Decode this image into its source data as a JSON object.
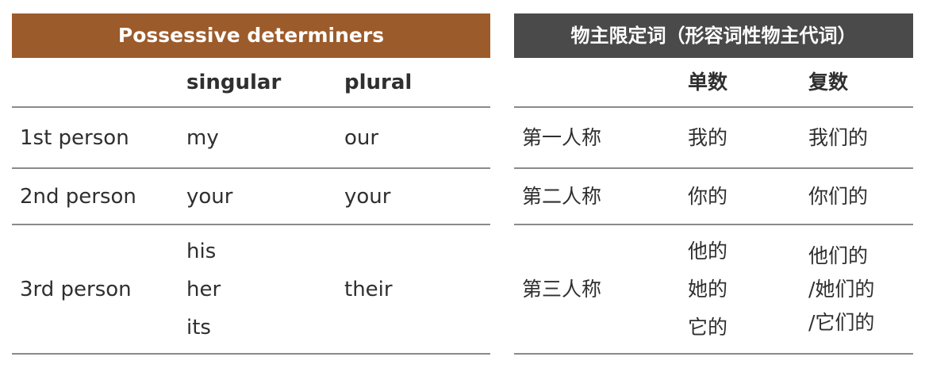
{
  "english_table": {
    "title": "Possessive determiners",
    "headers": [
      "",
      "singular",
      "plural"
    ],
    "rows": [
      {
        "person": "1st person",
        "singular": [
          "my"
        ],
        "plural": [
          "our"
        ]
      },
      {
        "person": "2nd person",
        "singular": [
          "your"
        ],
        "plural": [
          "your"
        ]
      },
      {
        "person": "3rd person",
        "singular": [
          "his",
          "her",
          "its"
        ],
        "plural": [
          "their"
        ]
      }
    ]
  },
  "chinese_table": {
    "title": "物主限定词（形容词性物主代词）",
    "headers": [
      "",
      "单数",
      "复数"
    ],
    "rows": [
      {
        "person": "第一人称",
        "singular": [
          "我的"
        ],
        "plural": [
          "我们的"
        ]
      },
      {
        "person": "第二人称",
        "singular": [
          "你的"
        ],
        "plural": [
          "你们的"
        ]
      },
      {
        "person": "第三人称",
        "singular": [
          "他的",
          "她的",
          "它的"
        ],
        "plural": [
          "他们的",
          "/她们的",
          "/它们的"
        ]
      }
    ]
  },
  "colors": {
    "english_banner": "#9c5b2b",
    "chinese_banner": "#4a4a4a",
    "divider": "#8a8a8a",
    "text": "#2f2f2f"
  }
}
